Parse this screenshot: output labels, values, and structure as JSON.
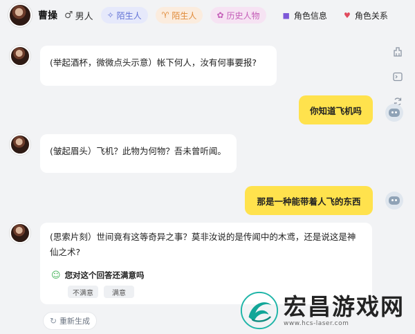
{
  "header": {
    "name": "曹操",
    "gender_label": "男人",
    "gender_icon": "male-icon",
    "tags": [
      {
        "label": "陌生人",
        "icon": "sparkle-icon",
        "color": "#6172d6"
      },
      {
        "label": "陌生人",
        "icon": "sprout-icon",
        "color": "#e08a38"
      },
      {
        "label": "历史人物",
        "icon": "gear-flower-icon",
        "color": "#c45eb8"
      }
    ],
    "links": [
      {
        "label": "角色信息",
        "icon": "info-icon"
      },
      {
        "label": "角色关系",
        "icon": "heart-icon"
      }
    ]
  },
  "messages": [
    {
      "role": "ai",
      "text": "(举起酒杯，微微点头示意）帐下何人，汝有何事要报?"
    },
    {
      "role": "user",
      "text": "你知道飞机吗"
    },
    {
      "role": "ai",
      "text": "(皱起眉头）飞机？此物为何物？吾未曾听闻。"
    },
    {
      "role": "user",
      "text": "那是一种能带着人飞的东西"
    },
    {
      "role": "ai",
      "text": "(思索片刻）世间竟有这等奇异之事？莫非汝说的是传闻中的木鸢，还是说这是神仙之术?"
    }
  ],
  "feedback": {
    "question": "您对这个回答还满意吗",
    "options": [
      "不满意",
      "满意"
    ]
  },
  "regenerate_label": "重新生成",
  "side_tools": [
    "cleaning-icon",
    "terminal-icon",
    "refresh-icon"
  ],
  "watermark": {
    "title": "宏昌游戏网",
    "url": "www.hcs-laser.com"
  },
  "colors": {
    "user_bubble": "#ffe24d",
    "background": "#f2f3f5"
  }
}
